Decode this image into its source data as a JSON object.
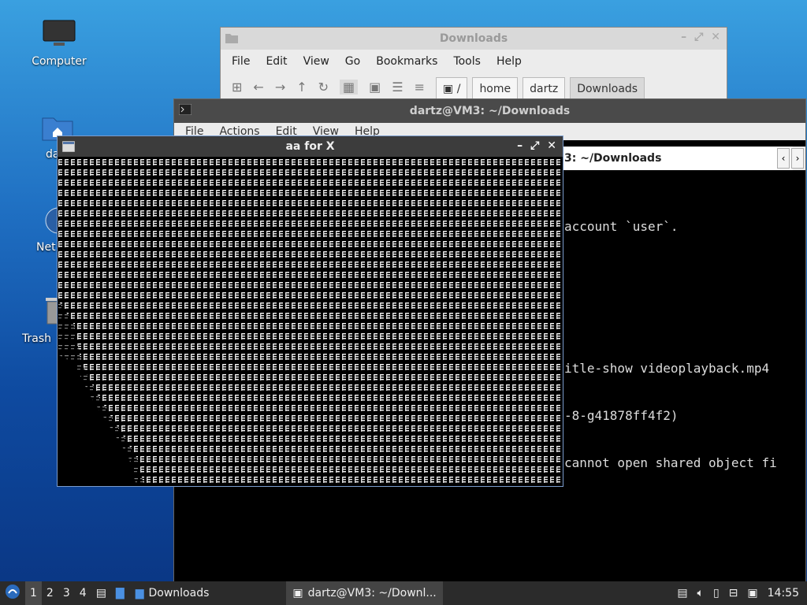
{
  "desktop": {
    "icons": [
      {
        "label": "Computer",
        "icon": "computer-icon"
      },
      {
        "label": "da",
        "icon": "home-folder-icon"
      },
      {
        "label": "Net",
        "icon": "network-icon"
      },
      {
        "label": "Trash",
        "icon": "trash-icon"
      }
    ]
  },
  "file_manager": {
    "title": "Downloads",
    "menu": [
      "File",
      "Edit",
      "View",
      "Go",
      "Bookmarks",
      "Tools",
      "Help"
    ],
    "path": [
      "/",
      "home",
      "dartz",
      "Downloads"
    ]
  },
  "terminal": {
    "title": "dartz@VM3: ~/Downloads",
    "menu": [
      "File",
      "Actions",
      "Edit",
      "View",
      "Help"
    ],
    "tab_label": "3: ~/Downloads",
    "lines": [
      "account `user`.",
      "",
      "",
      "itle-show videoplayback.mp4",
      "-8-g41878ff4f2)",
      "cannot open shared object fi"
    ]
  },
  "aa_window": {
    "title": "aa for X"
  },
  "taskbar": {
    "workspaces": [
      "1",
      "2",
      "3",
      "4"
    ],
    "windows": [
      {
        "label": "Downloads",
        "icon": "folder-icon"
      },
      {
        "label": "dartz@VM3: ~/Downl...",
        "icon": "terminal-icon"
      }
    ],
    "clock": "14:55"
  }
}
